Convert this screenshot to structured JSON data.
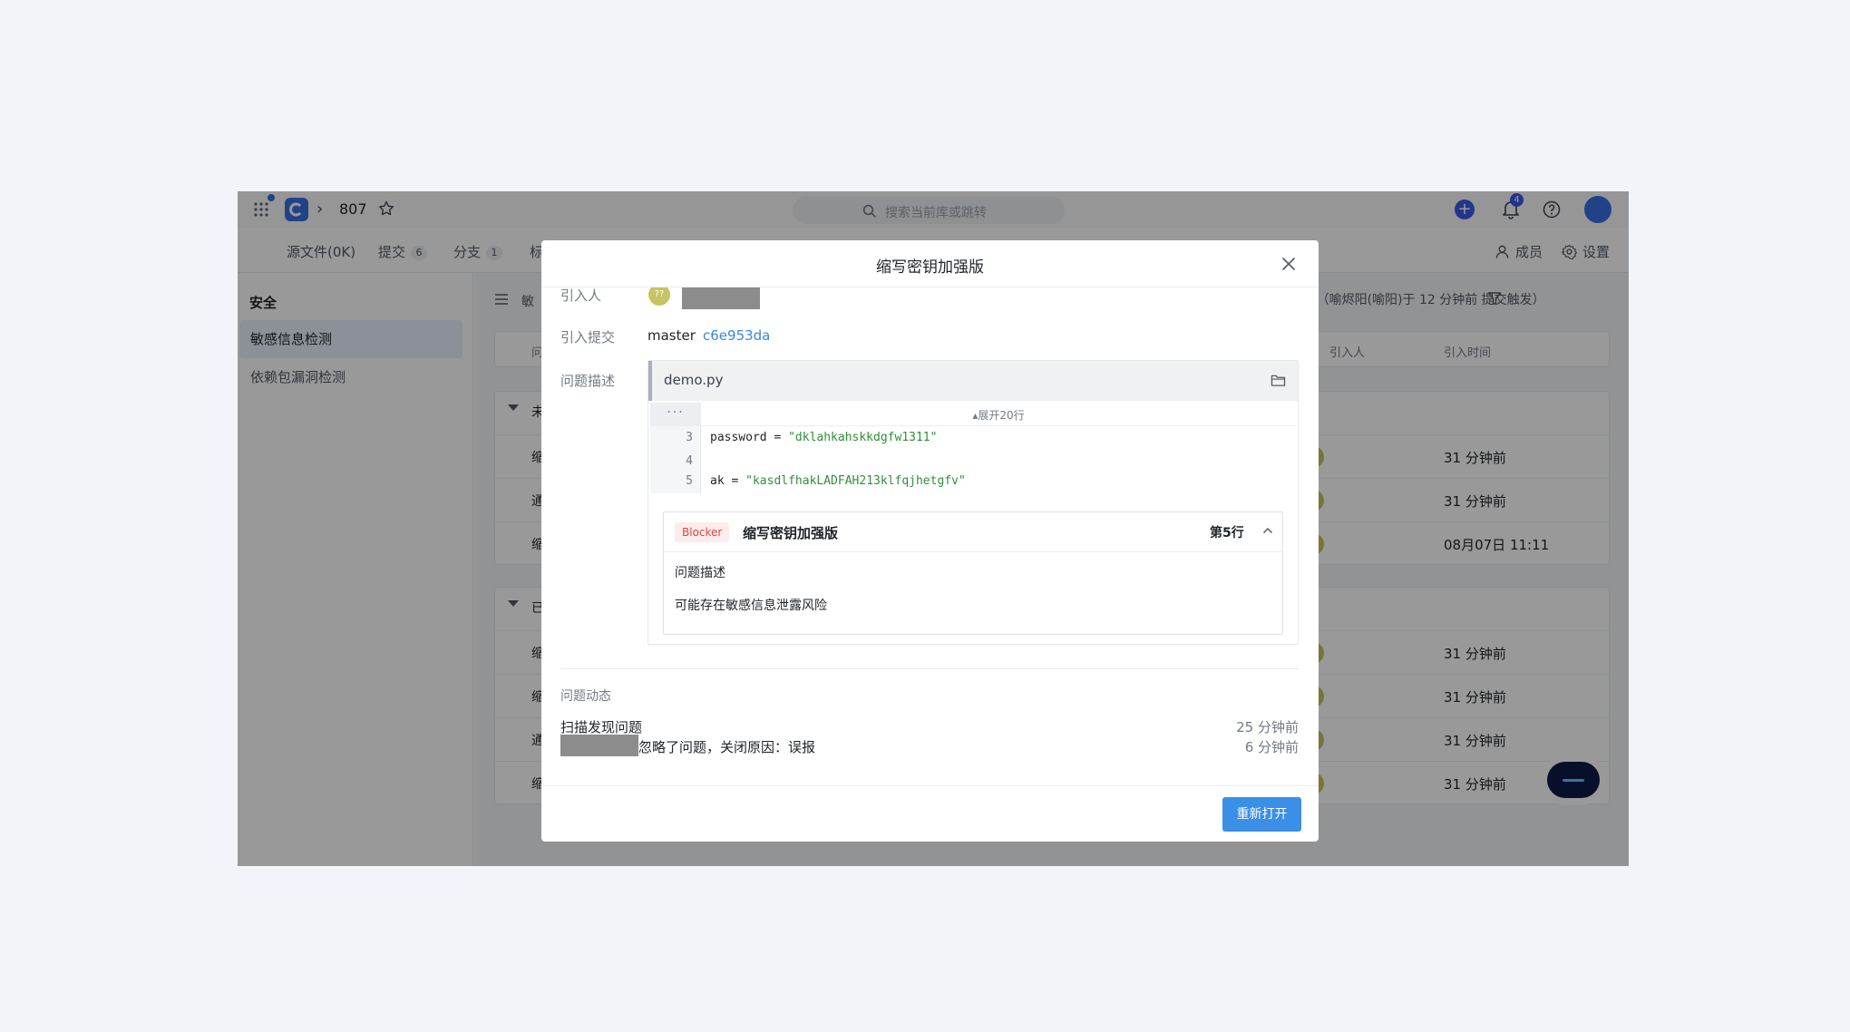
{
  "app": {
    "repo_id": "807",
    "search_placeholder": "搜索当前库或跳转",
    "notification_count": "4",
    "tabs": [
      {
        "label": "源文件(0K)",
        "count": ""
      },
      {
        "label": "提交",
        "count": "6"
      },
      {
        "label": "分支",
        "count": "1"
      },
      {
        "label": "标",
        "count": ""
      }
    ],
    "members_label": "成员",
    "settings_label": "设置"
  },
  "sidebar": {
    "title": "安全",
    "items": [
      {
        "label": "敏感信息检测",
        "active": true
      },
      {
        "label": "依赖包漏洞检测",
        "active": false
      }
    ]
  },
  "main": {
    "head_text": "敏",
    "trigger_text": "a（喻烬阳(喻阳)于 12 分钟前 提交触发）",
    "columns": {
      "first": "问",
      "introducer": "引入人",
      "time": "引入时间"
    },
    "group1_first": "未",
    "group1_rows": [
      {
        "first": "缩",
        "time": "31 分钟前"
      },
      {
        "first": "通",
        "time": "31 分钟前"
      },
      {
        "first": "缩",
        "time": "08月07日 11:11"
      }
    ],
    "group2_first": "已",
    "group2_rows": [
      {
        "first": "缩",
        "time": "31 分钟前"
      },
      {
        "first": "缩",
        "time": "31 分钟前"
      },
      {
        "first": "通",
        "time": "31 分钟前"
      },
      {
        "first": "缩",
        "time": "31 分钟前"
      }
    ]
  },
  "modal": {
    "title": "缩写密钥加强版",
    "labels": {
      "introducer": "引入人",
      "commit": "引入提交",
      "description": "问题描述"
    },
    "introducer_avatar_text": "??",
    "branch": "master",
    "commit_hash": "c6e953da",
    "file_name": "demo.py",
    "expand_label": "▴展开20行",
    "code_lines": [
      {
        "num": "3",
        "key": "password = ",
        "value": "\"dklahkahskkdgfw1311\""
      },
      {
        "num": "4",
        "key": "",
        "value": ""
      },
      {
        "num": "5",
        "key": "ak = ",
        "value": "\"kasdlfhakLADFAH213klfqjhetgfv\""
      }
    ],
    "issue": {
      "severity": "Blocker",
      "title": "缩写密钥加强版",
      "line": "第5行",
      "subtitle": "问题描述",
      "description": "可能存在敏感信息泄露风险"
    },
    "activity": {
      "title": "问题动态",
      "items": [
        {
          "text": "扫描发现问题",
          "time": "25 分钟前"
        },
        {
          "text": "忽略了问题，关闭原因：误报",
          "time": "6 分钟前"
        }
      ]
    },
    "reopen_label": "重新打开"
  }
}
